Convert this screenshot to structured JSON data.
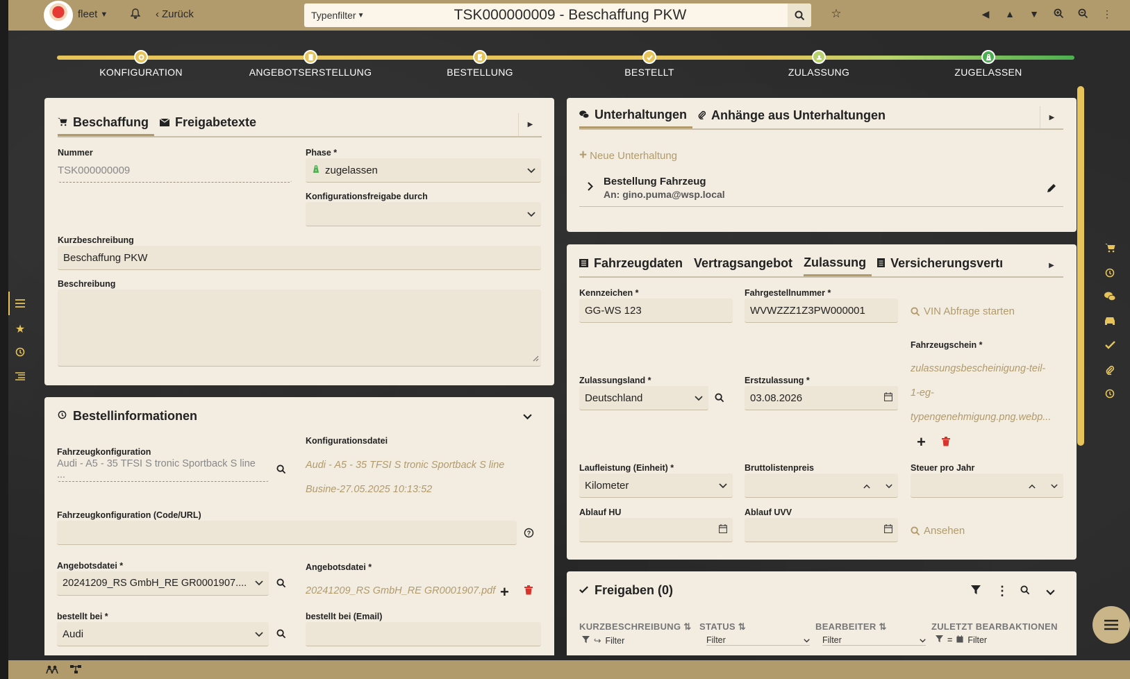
{
  "topbar": {
    "app_name": "fleet",
    "back_label": "Zurück",
    "typenfilter_label": "Typenfilter",
    "search_title": "TSK000000009 - Beschaffung PKW"
  },
  "stepper": {
    "steps": [
      "KONFIGURATION",
      "ANGEBOTSERSTELLUNG",
      "BESTELLUNG",
      "BESTELLT",
      "ZULASSUNG",
      "ZUGELASSEN"
    ],
    "progress": 1.0
  },
  "beschaffung": {
    "tabs": [
      "Beschaffung",
      "Freigabetexte"
    ],
    "nummer_label": "Nummer",
    "nummer_value": "TSK000000009",
    "phase_label": "Phase *",
    "phase_value": "zugelassen",
    "konfigfreigabe_label": "Konfigurationsfreigabe durch",
    "konfigfreigabe_value": "",
    "kurzbeschreibung_label": "Kurzbeschreibung",
    "kurzbeschreibung_value": "Beschaffung PKW",
    "beschreibung_label": "Beschreibung",
    "beschreibung_value": ""
  },
  "bestellinfo": {
    "title": "Bestellinformationen",
    "fahrzeugkonfig_label": "Fahrzeugkonfiguration",
    "fahrzeugkonfig_value": "Audi - A5 - 35 TFSI S tronic Sportback S line ...",
    "konfigdatei_label": "Konfigurationsdatei",
    "konfigdatei_line1": "Audi - A5 - 35 TFSI S tronic Sportback S line",
    "konfigdatei_line2": "Busine-27.05.2025 10:13:52",
    "konfig_code_label": "Fahrzeugkonfiguration (Code/URL)",
    "konfig_code_value": "",
    "angebotsdatei_label": "Angebotsdatei *",
    "angebotsdatei_value": "20241209_RS GmbH_RE GR0001907....",
    "angebotsdatei2_label": "Angebotsdatei *",
    "angebotsdatei2_value": "20241209_RS GmbH_RE GR0001907.pdf",
    "bestellt_bei_label": "bestellt bei *",
    "bestellt_bei_value": "Audi",
    "bestellt_email_label": "bestellt bei (Email)",
    "bestellt_email_value": ""
  },
  "unterhaltungen": {
    "tabs": [
      "Unterhaltungen",
      "Anhänge aus Unterhaltungen"
    ],
    "neue_label": "Neue Unterhaltung",
    "item_title": "Bestellung Fahrzeug",
    "item_to": "An: gino.puma@wsp.local"
  },
  "fahrzeug": {
    "tabs": [
      "Fahrzeugdaten",
      "Vertragsangebot",
      "Zulassung",
      "Versicherungsvertı"
    ],
    "kennzeichen_label": "Kennzeichen *",
    "kennzeichen_value": "GG-WS 123",
    "fin_label": "Fahrgestellnummer *",
    "fin_value": "WVWZZZ1Z3PW000001",
    "vin_link": "VIN Abfrage starten",
    "fahrzeugschein_label": "Fahrzeugschein *",
    "fahrzeugschein_lines": [
      "zulassungsbescheinigung-teil-",
      "1-eg-",
      "typengenehmigung.png.webp..."
    ],
    "zulassungsland_label": "Zulassungsland *",
    "zulassungsland_value": "Deutschland",
    "erstzulassung_label": "Erstzulassung *",
    "erstzulassung_value": "03.08.2026",
    "laufleistung_label": "Laufleistung (Einheit) *",
    "laufleistung_value": "Kilometer",
    "brutto_label": "Bruttolistenpreis",
    "brutto_value": "",
    "steuer_label": "Steuer pro Jahr",
    "steuer_value": "",
    "hu_label": "Ablauf HU",
    "hu_value": "",
    "uvv_label": "Ablauf UVV",
    "uvv_value": "",
    "ansehen_link": "Ansehen"
  },
  "freigaben": {
    "title": "Freigaben (0)",
    "columns": [
      "KURZBESCHREIBUNG",
      "STATUS",
      "BEARBEITER",
      "ZULETZT BEARBAKTIONEN"
    ],
    "filter_placeholder": "Filter"
  },
  "colors": {
    "accent": "#b19a6b",
    "stepper": "#e6c45a",
    "success": "#4caf50",
    "danger": "#d9342b",
    "panel": "#f3ede1"
  },
  "icons": {
    "left_rail": [
      "list-icon",
      "star-icon",
      "history-icon",
      "outline-icon"
    ],
    "right_rail": [
      "cart-icon",
      "history-icon",
      "chat-icon",
      "car-icon",
      "check-icon",
      "paperclip-icon",
      "history-icon"
    ]
  }
}
